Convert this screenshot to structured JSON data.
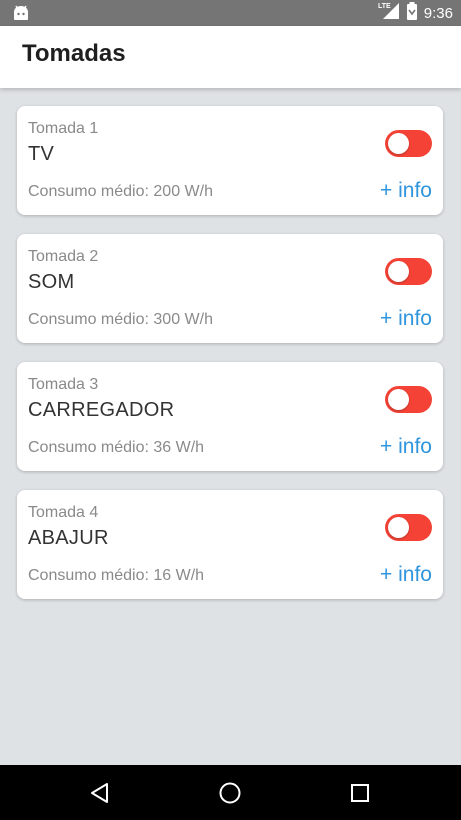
{
  "status_bar": {
    "time": "9:36",
    "network": "LTE",
    "icons": [
      "android-icon",
      "signal-icon",
      "battery-icon"
    ]
  },
  "app_bar": {
    "title": "Tomadas"
  },
  "cards": [
    {
      "label": "Tomada 1",
      "name": "TV",
      "consumo": "Consumo médio: 200 W/h",
      "info": "+ info",
      "on": false
    },
    {
      "label": "Tomada 2",
      "name": "SOM",
      "consumo": "Consumo médio: 300 W/h",
      "info": "+ info",
      "on": false
    },
    {
      "label": "Tomada 3",
      "name": "CARREGADOR",
      "consumo": "Consumo médio: 36 W/h",
      "info": "+ info",
      "on": false
    },
    {
      "label": "Tomada 4",
      "name": "ABAJUR",
      "consumo": "Consumo médio: 16 W/h",
      "info": "+ info",
      "on": false
    }
  ],
  "nav_bar": {
    "buttons": [
      "back-icon",
      "home-icon",
      "recents-icon"
    ]
  },
  "colors": {
    "toggle_off": "#f44336",
    "info_link": "#2f95dc",
    "background": "#dfe2e5"
  }
}
